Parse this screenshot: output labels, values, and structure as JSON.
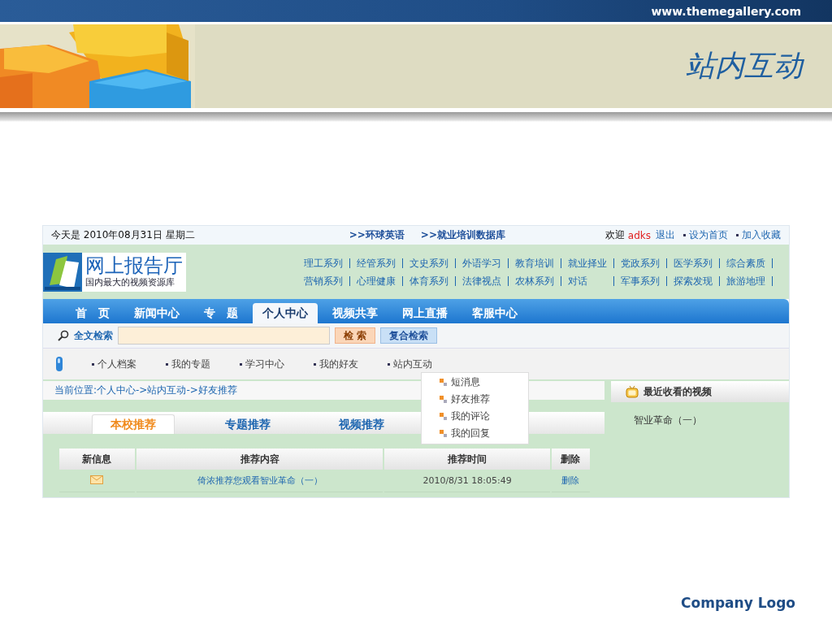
{
  "slide": {
    "site_url": "www.themegallery.com",
    "title": "站内互动",
    "footer": "Company Logo"
  },
  "page": {
    "top_bar": {
      "date": "今天是 2010年08月31日 星期二",
      "links": [
        ">>环球英语",
        ">>就业培训数据库"
      ],
      "welcome": "欢迎",
      "user": "adks",
      "logout": "退出",
      "actions": [
        "设为首页",
        "加入收藏"
      ]
    },
    "logo": {
      "title": "网上报告厅",
      "subtitle": "国内最大的视频资源库"
    },
    "categories": [
      [
        "理工系列",
        "经管系列",
        "文史系列",
        "外语学习",
        "教育培训",
        "就业择业",
        "党政系列",
        "医学系列",
        "综合素质"
      ],
      [
        "营销系列",
        "心理健康",
        "体育系列",
        "法律视点",
        "农林系列",
        "对话",
        "军事系列",
        "探索发现",
        "旅游地理"
      ]
    ],
    "nav_tabs": [
      {
        "label": "首　页",
        "selected": false
      },
      {
        "label": "新闻中心",
        "selected": false
      },
      {
        "label": "专　题",
        "selected": false
      },
      {
        "label": "个人中心",
        "selected": true
      },
      {
        "label": "视频共享",
        "selected": false
      },
      {
        "label": "网上直播",
        "selected": false
      },
      {
        "label": "客服中心",
        "selected": false
      }
    ],
    "search": {
      "label": "全文检索",
      "search_button": "检 索",
      "advanced_button": "复合检索"
    },
    "submenu": [
      "个人档案",
      "我的专题",
      "学习中心",
      "我的好友",
      "站内互动"
    ],
    "dropdown": [
      "短消息",
      "好友推荐",
      "我的评论",
      "我的回复"
    ],
    "breadcrumb": "当前位置:个人中心->站内互动->好友推荐",
    "content_tabs": [
      {
        "label": "本校推荐",
        "selected": true
      },
      {
        "label": "专题推荐",
        "selected": false
      },
      {
        "label": "视频推荐",
        "selected": false
      }
    ],
    "table": {
      "columns": [
        "新信息",
        "推荐内容",
        "推荐时间",
        "删除"
      ],
      "rows": [
        {
          "content": "倚浓推荐您观看智业革命（一）",
          "time": "2010/8/31 18:05:49",
          "action": "删除"
        }
      ]
    },
    "sidebar": {
      "title": "最近收看的视频",
      "items": [
        "智业革命（一）"
      ]
    }
  }
}
